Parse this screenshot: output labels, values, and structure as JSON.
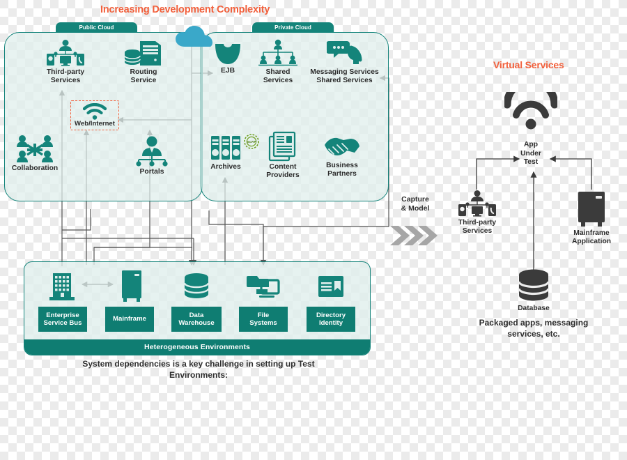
{
  "headings": {
    "left_title": "Increasing Development Complexity",
    "right_title": "Virtual Services"
  },
  "colors": {
    "teal": "#14847a",
    "teal_dark": "#0f7d72",
    "orange": "#f2603c",
    "cloud_blue": "#3aa8c9",
    "dark_icon": "#3b3b3b",
    "panel_fill": "#dfeeec",
    "wire": "#555555",
    "chevron": "#a6a6a6"
  },
  "clouds": {
    "public_tab": "Public Cloud",
    "private_tab": "Private Cloud"
  },
  "public_cloud_nodes": [
    {
      "id": "third-party-services",
      "icon": "devices-user-icon",
      "label": "Third-party\nServices"
    },
    {
      "id": "routing-service",
      "icon": "server-database-icon",
      "label": "Routing\nService"
    },
    {
      "id": "collaboration",
      "icon": "people-network-icon",
      "label": "Collaboration"
    },
    {
      "id": "portals",
      "icon": "people-hierarchy-icon",
      "label": "Portals"
    }
  ],
  "web_internet": {
    "id": "web-internet",
    "icon": "wifi-icon",
    "label": "Web/Internet"
  },
  "private_cloud_nodes": [
    {
      "id": "ejb",
      "icon": "bean-icon",
      "label": "EJB"
    },
    {
      "id": "shared-services",
      "icon": "org-chart-icon",
      "label": "Shared\nServices"
    },
    {
      "id": "messaging-services",
      "icon": "chat-phone-icon",
      "label": "Messaging Services\nShared Services"
    },
    {
      "id": "archives",
      "icon": "binders-icon",
      "label": "Archives"
    },
    {
      "id": "content-providers",
      "icon": "documents-icon",
      "label": "Content\nProviders"
    },
    {
      "id": "business-partners",
      "icon": "handshake-icon",
      "label": "Business\nPartners"
    }
  ],
  "soap_badge": {
    "id": "soap-badge",
    "label": "SOAP"
  },
  "environments": {
    "footer_label": "Heterogeneous Environments",
    "items": [
      {
        "id": "enterprise-service-bus",
        "icon": "building-icon",
        "label": "Enterprise\nService Bus"
      },
      {
        "id": "mainframe",
        "icon": "mainframe-icon",
        "label": "Mainframe"
      },
      {
        "id": "data-warehouse",
        "icon": "database-icon",
        "label": "Data\nWarehouse"
      },
      {
        "id": "file-systems",
        "icon": "folder-monitor-icon",
        "label": "File\nSystems"
      },
      {
        "id": "directory-identity",
        "icon": "id-card-icon",
        "label": "Directory\nIdentity"
      }
    ]
  },
  "caption_bottom_left": "System dependencies is a key challenge in setting up Test\nEnvironments:",
  "transition": {
    "label": "Capture\n& Model",
    "icon": "chevrons-right-icon"
  },
  "virtual_services": {
    "app_under_test": {
      "id": "app-under-test",
      "icon": "wifi-icon",
      "label": "App\nUnder\nTest"
    },
    "nodes": [
      {
        "id": "vs-third-party-services",
        "icon": "devices-user-icon",
        "label": "Third-party\nServices"
      },
      {
        "id": "vs-mainframe-application",
        "icon": "mainframe-icon",
        "label": "Mainframe\nApplication"
      },
      {
        "id": "vs-database",
        "icon": "database-icon",
        "label": "Database"
      }
    ],
    "caption": "Packaged apps, messaging\nservices, etc."
  }
}
